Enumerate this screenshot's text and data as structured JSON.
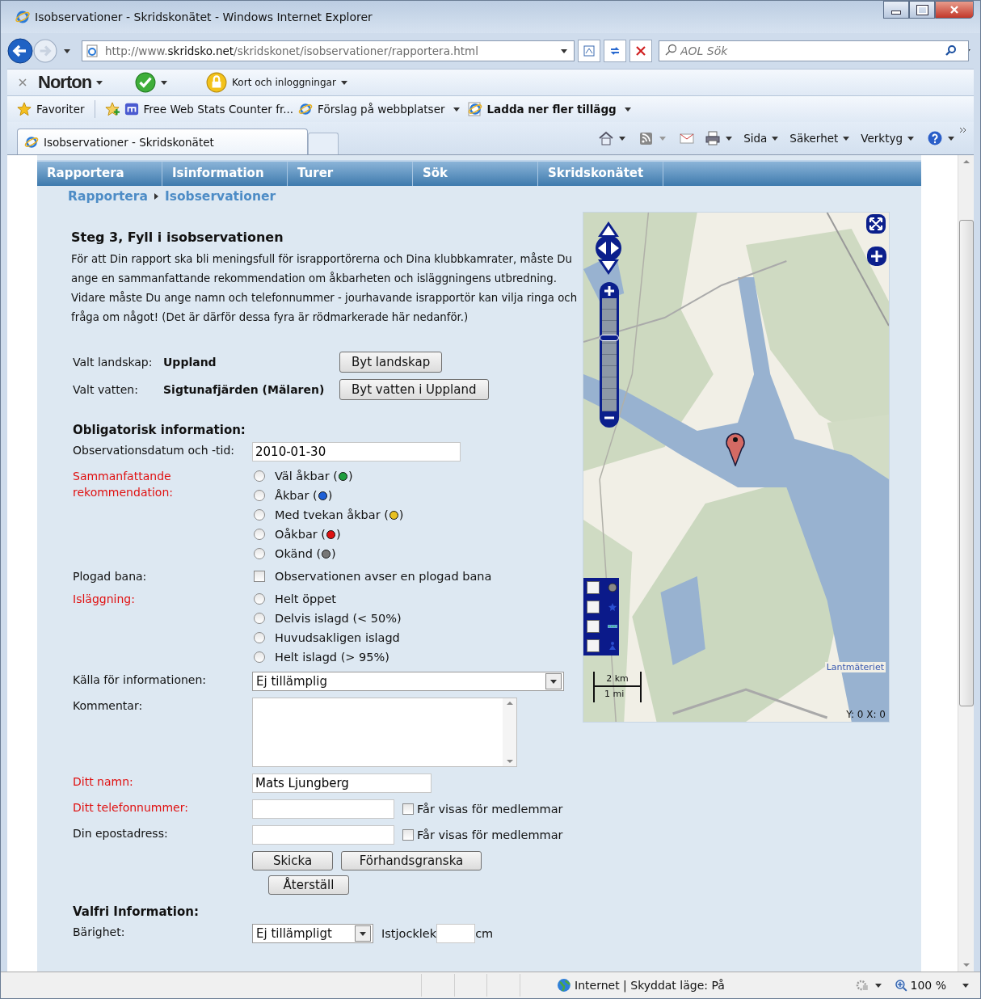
{
  "window": {
    "title": "Isobservationer - Skridskonätet - Windows Internet Explorer"
  },
  "address_bar": {
    "url": "http://www.**skridsko.net**/skridskonet/isobservationer/rapportera.html"
  },
  "search": {
    "placeholder": "AOL Sök"
  },
  "norton_bar": {
    "brand": "Norton",
    "cards": "Kort och inloggningar"
  },
  "favorites_bar": {
    "favorites": "Favoriter",
    "links": [
      {
        "label": "Free Web Stats Counter fr...",
        "kind": "site"
      },
      {
        "label": "Förslag på webbplatser",
        "kind": "suggested"
      },
      {
        "label": "Ladda ner fler tillägg",
        "kind": "addons"
      }
    ]
  },
  "tabs": [
    {
      "label": "Isobservationer - Skridskonätet",
      "selected": true
    }
  ],
  "command_bar": {
    "menus": [
      "Sida",
      "Säkerhet",
      "Verktyg"
    ]
  },
  "site_nav": [
    "Rapportera",
    "Isinformation",
    "Turer",
    "Sök",
    "Skridskonätet"
  ],
  "breadcrumb": [
    "Rapportera",
    "Isobservationer"
  ],
  "heading": "Steg 3, Fyll i isobservationen",
  "intro": "För att Din rapport ska bli meningsfull för israpportörerna och Dina klubbkamrater, måste Du ange en sammanfattande rekommendation om åkbarheten och isläggningens utbredning. Vidare måste Du ange namn och telefonnummer - jourhavande israpportör kan vilja ringa och fråga om något! (Det är därför dessa fyra är rödmarkerade här nedanför.)",
  "selection": [
    {
      "label": "Valt landskap:",
      "value": "Uppland",
      "button": "Byt landskap"
    },
    {
      "label": "Valt vatten:",
      "value": "Sigtunafjärden (Mälaren)",
      "button": "Byt vatten i Uppland"
    }
  ],
  "mandatory": {
    "title": "Obligatorisk information:",
    "date": {
      "label": "Observationsdatum och -tid:",
      "required": false,
      "value": "2010-01-30"
    },
    "recommendation": {
      "label": "Sammanfattande rekommendation:",
      "required": true,
      "options": [
        {
          "prefix": "Väl åkbar (",
          "suffix": ")",
          "color": "#1e9e3e",
          "selected": false
        },
        {
          "prefix": "Åkbar (",
          "suffix": ")",
          "color": "#1d5fd6",
          "selected": false
        },
        {
          "prefix": "Med tvekan åkbar (",
          "suffix": ")",
          "color": "#e8c020",
          "selected": false
        },
        {
          "prefix": "Oåkbar (",
          "suffix": ")",
          "color": "#dd1111",
          "selected": false
        },
        {
          "prefix": "Okänd (",
          "suffix": ")",
          "color": "#777777",
          "selected": false
        }
      ]
    },
    "plowed": {
      "label": "Plogad bana:",
      "required": false,
      "option": "Observationen avser en plogad bana",
      "checked": false
    },
    "ice_cover": {
      "label": "Isläggning:",
      "required": true,
      "options": [
        {
          "label": "Helt öppet",
          "selected": false
        },
        {
          "label": "Delvis islagd (< 50%)",
          "selected": false
        },
        {
          "label": "Huvudsakligen islagd",
          "selected": false
        },
        {
          "label": "Helt islagd (> 95%)",
          "selected": false
        }
      ]
    },
    "source": {
      "label": "Källa för informationen:",
      "required": false,
      "value": "Ej tillämplig"
    },
    "comment": {
      "label": "Kommentar:",
      "required": false
    },
    "name": {
      "label": "Ditt namn:",
      "required": true,
      "value": "Mats Ljungberg"
    },
    "phone": {
      "label": "Ditt telefonnummer:",
      "required": true,
      "show_members": {
        "label": "Får visas för medlemmar",
        "checked": false
      }
    },
    "email": {
      "label": "Din epostadress:",
      "required": false,
      "show_members": {
        "label": "Får visas för medlemmar",
        "checked": false
      }
    }
  },
  "buttons": [
    "Skicka",
    "Förhandsgranska",
    "Återställ"
  ],
  "optional": {
    "title": "Valfri Information:",
    "bearing": {
      "label": "Bärighet:",
      "value": "Ej tillämpligt"
    },
    "thickness": {
      "label": "Istjocklek",
      "unit": "cm"
    }
  },
  "map": {
    "kind": "picture",
    "zoom": {
      "level": 0.65
    },
    "scale": [
      "2 km",
      "1 mi"
    ],
    "coords": "Y: 0 X: 0",
    "attribution": "Lantmäteriet",
    "layers": [
      {
        "kind": "dot",
        "checked": false
      },
      {
        "kind": "star",
        "checked": false
      },
      {
        "kind": "road",
        "checked": false
      },
      {
        "kind": "figure",
        "checked": false
      }
    ]
  },
  "status_bar": {
    "zone": "Internet | Skyddat läge: På",
    "zoom": "100 %"
  }
}
